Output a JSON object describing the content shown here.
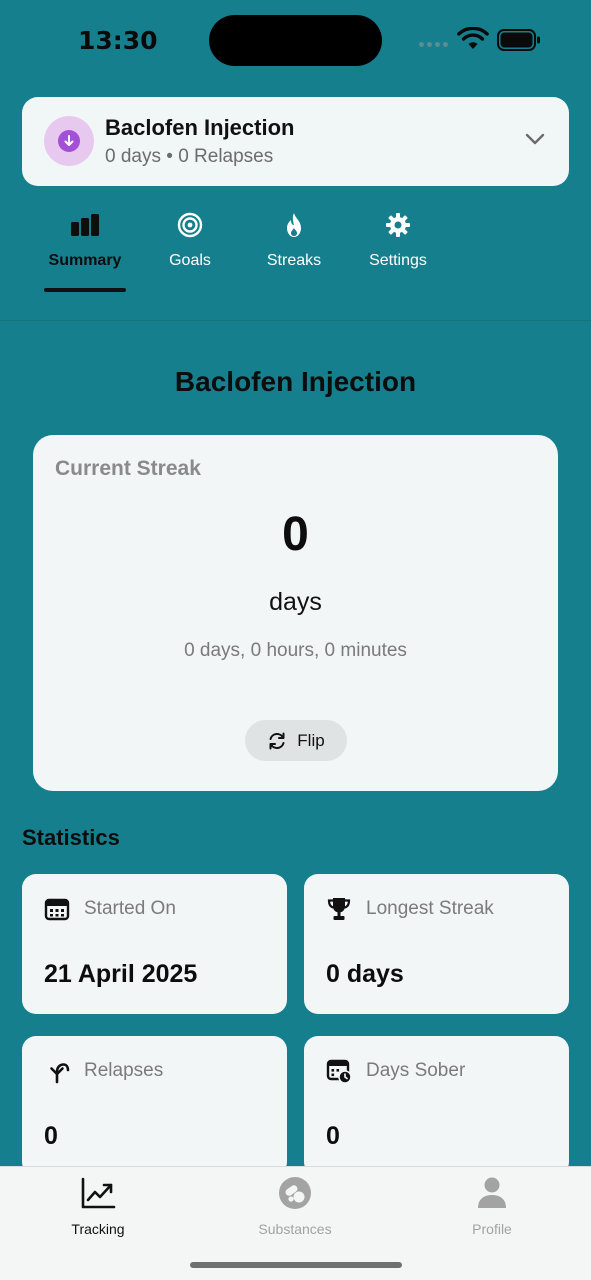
{
  "status_bar": {
    "time": "13:30"
  },
  "selector": {
    "title": "Baclofen Injection",
    "subtitle": "0 days • 0 Relapses",
    "avatar_color": "#a34fd6",
    "avatar_bg": "#e7c9ef"
  },
  "tabs": [
    {
      "label": "Summary",
      "icon": "bar-chart-icon",
      "active": true
    },
    {
      "label": "Goals",
      "icon": "target-icon"
    },
    {
      "label": "Streaks",
      "icon": "flame-icon"
    },
    {
      "label": "Settings",
      "icon": "gear-icon"
    }
  ],
  "page_title": "Baclofen Injection",
  "streak": {
    "heading": "Current Streak",
    "value": "0",
    "unit": "days",
    "detail": "0 days, 0 hours, 0 minutes",
    "flip_label": "Flip"
  },
  "statistics": {
    "title": "Statistics",
    "cards": [
      {
        "label": "Started On",
        "value": "21 April 2025",
        "icon": "calendar-icon"
      },
      {
        "label": "Longest Streak",
        "value": "0 days",
        "icon": "trophy-icon"
      },
      {
        "label": "Relapses",
        "value": "0",
        "icon": "undo-arrow-icon"
      },
      {
        "label": "Days Sober",
        "value": "0",
        "icon": "calendar-clock-icon"
      }
    ]
  },
  "bottom_nav": [
    {
      "label": "Tracking",
      "icon": "trend-chart-icon",
      "active": true
    },
    {
      "label": "Substances",
      "icon": "pills-icon"
    },
    {
      "label": "Profile",
      "icon": "person-icon"
    }
  ],
  "colors": {
    "background": "#167f8d",
    "card": "#f2f6f6",
    "accent": "#a34fd6"
  }
}
